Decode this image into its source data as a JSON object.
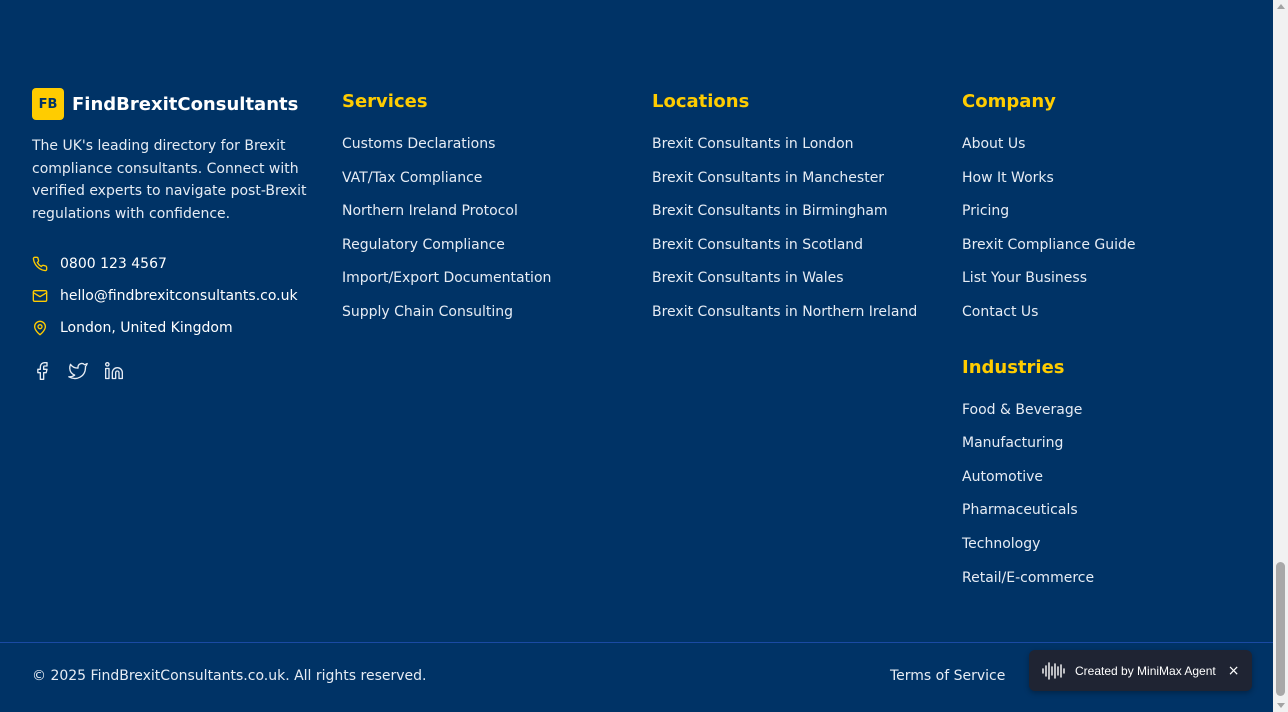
{
  "brand": {
    "logo_text": "FB",
    "name": "FindBrexitConsultants",
    "description": "The UK's leading directory for Brexit compliance consultants. Connect with verified experts to navigate post-Brexit regulations with confidence.",
    "phone": "0800 123 4567",
    "email": "hello@findbrexitconsultants.co.uk",
    "location": "London, United Kingdom",
    "social_icons": [
      "facebook-icon",
      "twitter-icon",
      "linkedin-icon"
    ]
  },
  "services": {
    "heading": "Services",
    "items": [
      "Customs Declarations",
      "VAT/Tax Compliance",
      "Northern Ireland Protocol",
      "Regulatory Compliance",
      "Import/Export Documentation",
      "Supply Chain Consulting"
    ]
  },
  "locations": {
    "heading": "Locations",
    "items": [
      "Brexit Consultants in London",
      "Brexit Consultants in Manchester",
      "Brexit Consultants in Birmingham",
      "Brexit Consultants in Scotland",
      "Brexit Consultants in Wales",
      "Brexit Consultants in Northern Ireland"
    ]
  },
  "company": {
    "heading": "Company",
    "items": [
      "About Us",
      "How It Works",
      "Pricing",
      "Brexit Compliance Guide",
      "List Your Business",
      "Contact Us"
    ]
  },
  "industries": {
    "heading": "Industries",
    "items": [
      "Food & Beverage",
      "Manufacturing",
      "Automotive",
      "Pharmaceuticals",
      "Technology",
      "Retail/E-commerce"
    ]
  },
  "bottom": {
    "copyright": "© 2025 FindBrexitConsultants.co.uk. All rights reserved.",
    "terms": "Terms of Service"
  },
  "agent_badge": {
    "text": "Created by MiniMax Agent",
    "close": "×"
  },
  "colors": {
    "background": "#003366",
    "accent": "#ffcc00",
    "text": "#e6ecf4"
  }
}
